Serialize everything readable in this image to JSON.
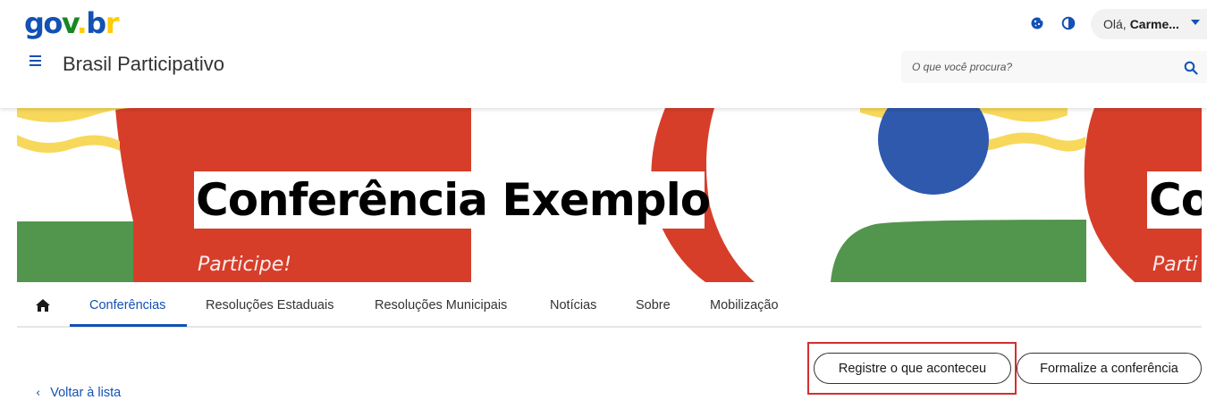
{
  "header": {
    "logo": {
      "g": "g",
      "o": "o",
      "v": "v",
      "dot": ".",
      "b": "b",
      "r": "r"
    },
    "user_greeting": "Olá,",
    "user_name": "Carme...",
    "site_title": "Brasil Participativo",
    "search_placeholder": "O que você procura?",
    "icons": [
      "cookie-icon",
      "contrast-icon",
      "search-icon",
      "hamburger-menu-icon"
    ]
  },
  "banner": {
    "title": "Conferência Exemplo",
    "subtitle": "Participe!",
    "title_repeat": "Co",
    "subtitle_repeat": "Parti",
    "colors": {
      "red": "#d63e2a",
      "yellow": "#f7d85b",
      "blue": "#2e59ad",
      "green": "#52954d"
    }
  },
  "nav": {
    "tabs": [
      {
        "label": "Conferências",
        "active": true
      },
      {
        "label": "Resoluções Estaduais",
        "active": false
      },
      {
        "label": "Resoluções Municipais",
        "active": false
      },
      {
        "label": "Notícias",
        "active": false
      },
      {
        "label": "Sobre",
        "active": false
      },
      {
        "label": "Mobilização",
        "active": false
      }
    ]
  },
  "actions": {
    "register_label": "Registre o que aconteceu",
    "formalize_label": "Formalize a conferência"
  },
  "back_link": "Voltar à lista",
  "colors": {
    "primary": "#1351b4",
    "highlight": "#d32f2f"
  }
}
